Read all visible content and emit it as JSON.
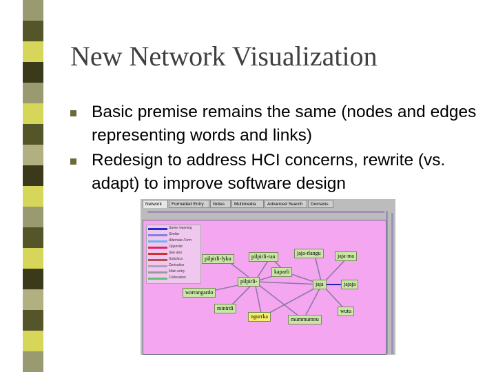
{
  "slide": {
    "title": "New Network Visualization",
    "bullets": [
      "Basic premise remains the same (nodes and edges representing words and links)",
      "Redesign to address HCI concerns, rewrite (vs. adapt) to improve software design"
    ]
  },
  "colors": {
    "title": "#404040",
    "bullet": "#6b6b3a",
    "canvas": "#f5a6f0",
    "node": "#c9e6a6",
    "node_selected": "#f6ef6a"
  },
  "app": {
    "tabs": [
      "Network",
      "Formatted Entry",
      "Notes",
      "Multimedia",
      "Advanced Search",
      "Domains"
    ],
    "active_tab": "Network",
    "legend": [
      {
        "label": "Same meaning",
        "color": "#2b2bd0"
      },
      {
        "label": "Similar",
        "color": "#7f7fe0"
      },
      {
        "label": "Alternate Form",
        "color": "#6fb0f0"
      },
      {
        "label": "Opposite",
        "color": "#e0206a"
      },
      {
        "label": "See also",
        "color": "#d03030"
      },
      {
        "label": "Subclass",
        "color": "#b05050"
      },
      {
        "label": "Derivative",
        "color": "#b0a0c0"
      },
      {
        "label": "Main entry",
        "color": "#9a9a9a"
      },
      {
        "label": "Collocation",
        "color": "#60c070"
      }
    ],
    "nodes": [
      {
        "id": "jaja-rlangu",
        "label": "jaja-rlangu"
      },
      {
        "id": "jaja-ma",
        "label": "jaja-ma"
      },
      {
        "id": "pilpirli-ryku",
        "label": "pilpirli-lyku"
      },
      {
        "id": "pilpirli-ran",
        "label": "pilpirli-ran"
      },
      {
        "id": "kaparli",
        "label": "kaparli"
      },
      {
        "id": "pilpirli",
        "label": "pilpirli-"
      },
      {
        "id": "jaja",
        "label": "jaja"
      },
      {
        "id": "jajaja",
        "label": "jajaja"
      },
      {
        "id": "warrangardo",
        "label": "warrangardo"
      },
      {
        "id": "minirdi",
        "label": "minirdi"
      },
      {
        "id": "wutu",
        "label": "wutu"
      },
      {
        "id": "ngurrka",
        "label": "ngurrka"
      },
      {
        "id": "mummumnu",
        "label": "mummumnu"
      }
    ]
  }
}
